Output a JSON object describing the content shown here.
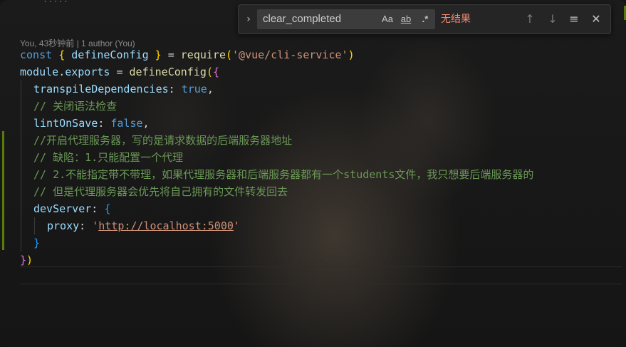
{
  "blame": "You, 43秒钟前 | 1 author (You)",
  "find": {
    "query": "clear_completed",
    "match_case_label": "Aa",
    "whole_word_label": "ab",
    "regex_label": ".*",
    "status": "无结果",
    "toggle_icon": "chevron-right-icon",
    "prev_icon": "arrow-up-icon",
    "next_icon": "arrow-down-icon",
    "selection_icon": "list-selection-icon",
    "close_icon": "close-icon"
  },
  "code": {
    "l1": {
      "kw": "const",
      "sp1": " ",
      "ob": "{",
      "name": " defineConfig ",
      "cb": "}",
      "eq": " = ",
      "fn": "require",
      "op": "(",
      "str": "'@vue/cli-service'",
      "cp": ")"
    },
    "l2": {
      "obj": "module",
      "dot": ".",
      "prop": "exports",
      "eq": " = ",
      "fn": "defineConfig",
      "op": "(",
      "ob": "{"
    },
    "l3": {
      "key": "transpileDependencies",
      "colon": ": ",
      "val": "true",
      "comma": ","
    },
    "l4": "// 关闭语法检查",
    "l5": {
      "key": "lintOnSave",
      "colon": ": ",
      "val": "false",
      "comma": ","
    },
    "l6": "//开启代理服务器，写的是请求数据的后端服务器地址",
    "l7": "// 缺陷：1.只能配置一个代理",
    "l8": "// 2.不能指定带不带理，如果代理服务器和后端服务器都有一个students文件，我只想要后端服务器的",
    "l9": "// 但是代理服务器会优先将自己拥有的文件转发回去",
    "l10": {
      "key": "devServer",
      "colon": ": ",
      "ob": "{"
    },
    "l11": {
      "key": "proxy",
      "colon": ": ",
      "q1": "'",
      "url": "http://localhost:5000",
      "q2": "'"
    },
    "l12": "}",
    "l13": {
      "cb": "}",
      "cp": ")"
    }
  },
  "colors": {
    "keyword": "#569cd6",
    "string": "#ce9178",
    "comment": "#6a9955",
    "error": "#f48771"
  }
}
